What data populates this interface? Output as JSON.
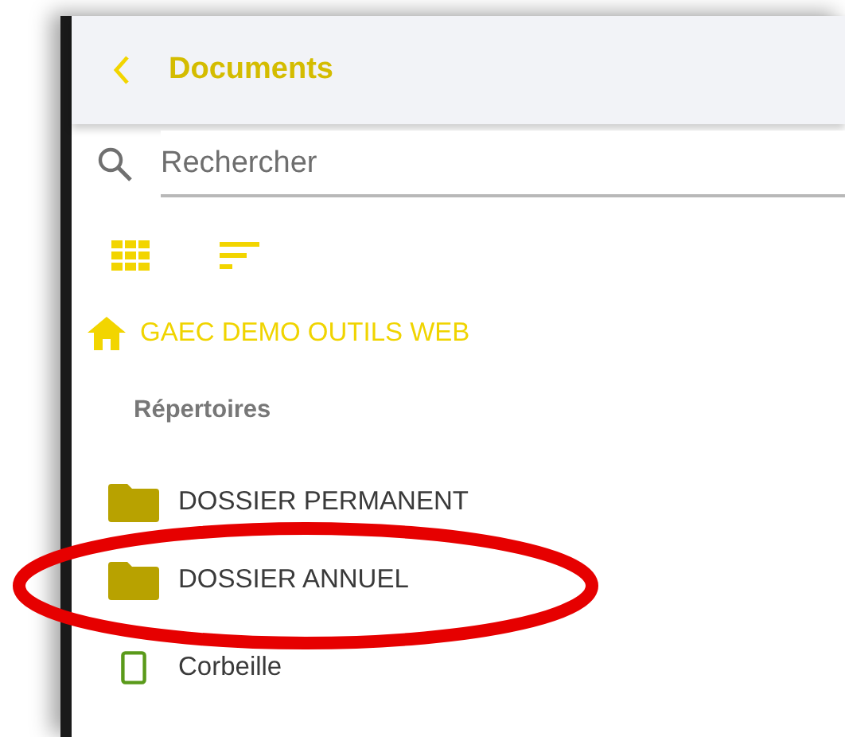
{
  "header": {
    "title": "Documents"
  },
  "search": {
    "placeholder": "Rechercher"
  },
  "breadcrumb": {
    "label": "GAEC DEMO OUTILS WEB"
  },
  "section": {
    "title": "Répertoires"
  },
  "items": [
    {
      "kind": "folder",
      "label": "DOSSIER PERMANENT"
    },
    {
      "kind": "folder",
      "label": "DOSSIER ANNUEL"
    },
    {
      "kind": "trash",
      "label": "Corbeille"
    }
  ],
  "annotation": {
    "kind": "ellipse"
  }
}
